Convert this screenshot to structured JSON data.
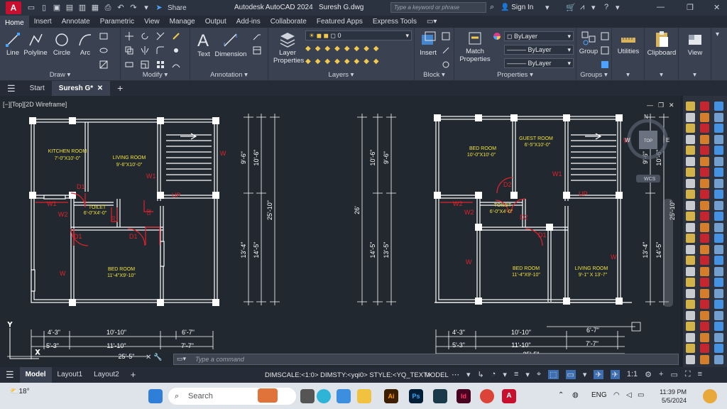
{
  "titlebar": {
    "app_logo": "A",
    "share_label": "Share",
    "title": "Autodesk AutoCAD 2024",
    "file": "Suresh G.dwg",
    "search_placeholder": "Type a keyword or phrase",
    "signin_label": "Sign In"
  },
  "ribbon_tabs": [
    "Home",
    "Insert",
    "Annotate",
    "Parametric",
    "View",
    "Manage",
    "Output",
    "Add-ins",
    "Collaborate",
    "Featured Apps",
    "Express Tools"
  ],
  "ribbon": {
    "draw": {
      "label": "Draw",
      "tools": [
        "Line",
        "Polyline",
        "Circle",
        "Arc"
      ]
    },
    "modify": {
      "label": "Modify"
    },
    "annotation": {
      "label": "Annotation",
      "tools": [
        "Text",
        "Dimension"
      ]
    },
    "layers": {
      "label": "Layers",
      "layer_properties": "Layer Properties",
      "current_layer": "0"
    },
    "block": {
      "label": "Block",
      "insert": "Insert"
    },
    "properties": {
      "label": "Properties",
      "match": "Match Properties",
      "color": "ByLayer",
      "linetype": "ByLayer",
      "lineweight": "ByLayer"
    },
    "groups": {
      "label": "Groups",
      "group": "Group"
    },
    "utilities": {
      "label": "Utilities"
    },
    "clipboard": {
      "label": "Clipboard"
    },
    "view": {
      "label": "View"
    }
  },
  "doc_tabs": {
    "start": "Start",
    "active": "Suresh G*"
  },
  "viewport_label": "[−][Top][2D Wireframe]",
  "viewcube": {
    "top": "TOP",
    "wcs": "WCS",
    "n": "N",
    "w": "W",
    "e": "E"
  },
  "plan1": {
    "rooms": [
      {
        "name": "KITCHEN ROOM",
        "size": "7'-0\"X10'-0\""
      },
      {
        "name": "LIVING ROOM",
        "size": "9'-6\"X10'-0\""
      },
      {
        "name": "TOILET",
        "size": "6'-0\"X4'-0\""
      },
      {
        "name": "BED ROOM",
        "size": "11'-4\"X9'-10\""
      }
    ],
    "tags": [
      "D1",
      "D1",
      "D1",
      "D2",
      "D3",
      "W",
      "W1",
      "W2",
      "W2",
      "W",
      "UP"
    ],
    "bottom_dims_row1": [
      "4'-3\"",
      "10'-10\"",
      "6'-7\""
    ],
    "bottom_dims_row2": [
      "5'-3\"",
      "11'-10\"",
      "7'-7\""
    ],
    "total": "25'-5\""
  },
  "dims_mid": {
    "left_outer": "25'-10\"",
    "left_a": [
      "9'-6\"",
      "13'-4\""
    ],
    "left_b": [
      "10'-6\"",
      "14'-5\""
    ],
    "right_outer": "26'",
    "right_a": [
      "10'-6\"",
      "14'-5\""
    ],
    "right_b": [
      "9'-6\"",
      "13'-5\""
    ]
  },
  "plan2": {
    "rooms": [
      {
        "name": "BED ROOM",
        "size": "10'-0\"X10'-0\""
      },
      {
        "name": "GUEST ROOM",
        "size": "6'-5\"X10'-0\""
      },
      {
        "name": "TOILET",
        "size": "6'-0\"X4'-0\""
      },
      {
        "name": "BED ROOM",
        "size": "11'-4\"X9'-10\""
      },
      {
        "name": "LIVING  ROOM",
        "size": "9'-1\" X 13'-7\""
      }
    ],
    "tags": [
      "D2",
      "D2",
      "D1",
      "W",
      "W1",
      "W2",
      "W2",
      "W",
      "W",
      "UP"
    ],
    "right_dims": [
      "9'-6\"",
      "10'-6\"",
      "25'-10\"",
      "13'-4\"",
      "14'-5\""
    ],
    "bottom_dims_row1": [
      "4'-3\"",
      "10'-10\"",
      "6'-7\""
    ],
    "bottom_dims_row2": [
      "5'-3\"",
      "11'-10\"",
      "7'-7\""
    ],
    "total": "25'-5\""
  },
  "command_placeholder": "Type a command",
  "status": {
    "layouts": [
      "Model",
      "Layout1",
      "Layout2"
    ],
    "dim_info": "DIMSCALE:<1:0> DIMSTY:<yqi0> STYLE:<YQ_TEXT>",
    "model_btn": "MODEL",
    "scale": "1:1"
  },
  "taskbar": {
    "weather": "18°",
    "search": "Search",
    "lang": "ENG",
    "time": "11:39 PM",
    "date": "5/5/2024"
  },
  "colors": {
    "room_text": "#f2e33a",
    "door_red": "#e0232b",
    "walls": "#ffffff",
    "dims": "#ffffff",
    "bg": "#212830"
  }
}
